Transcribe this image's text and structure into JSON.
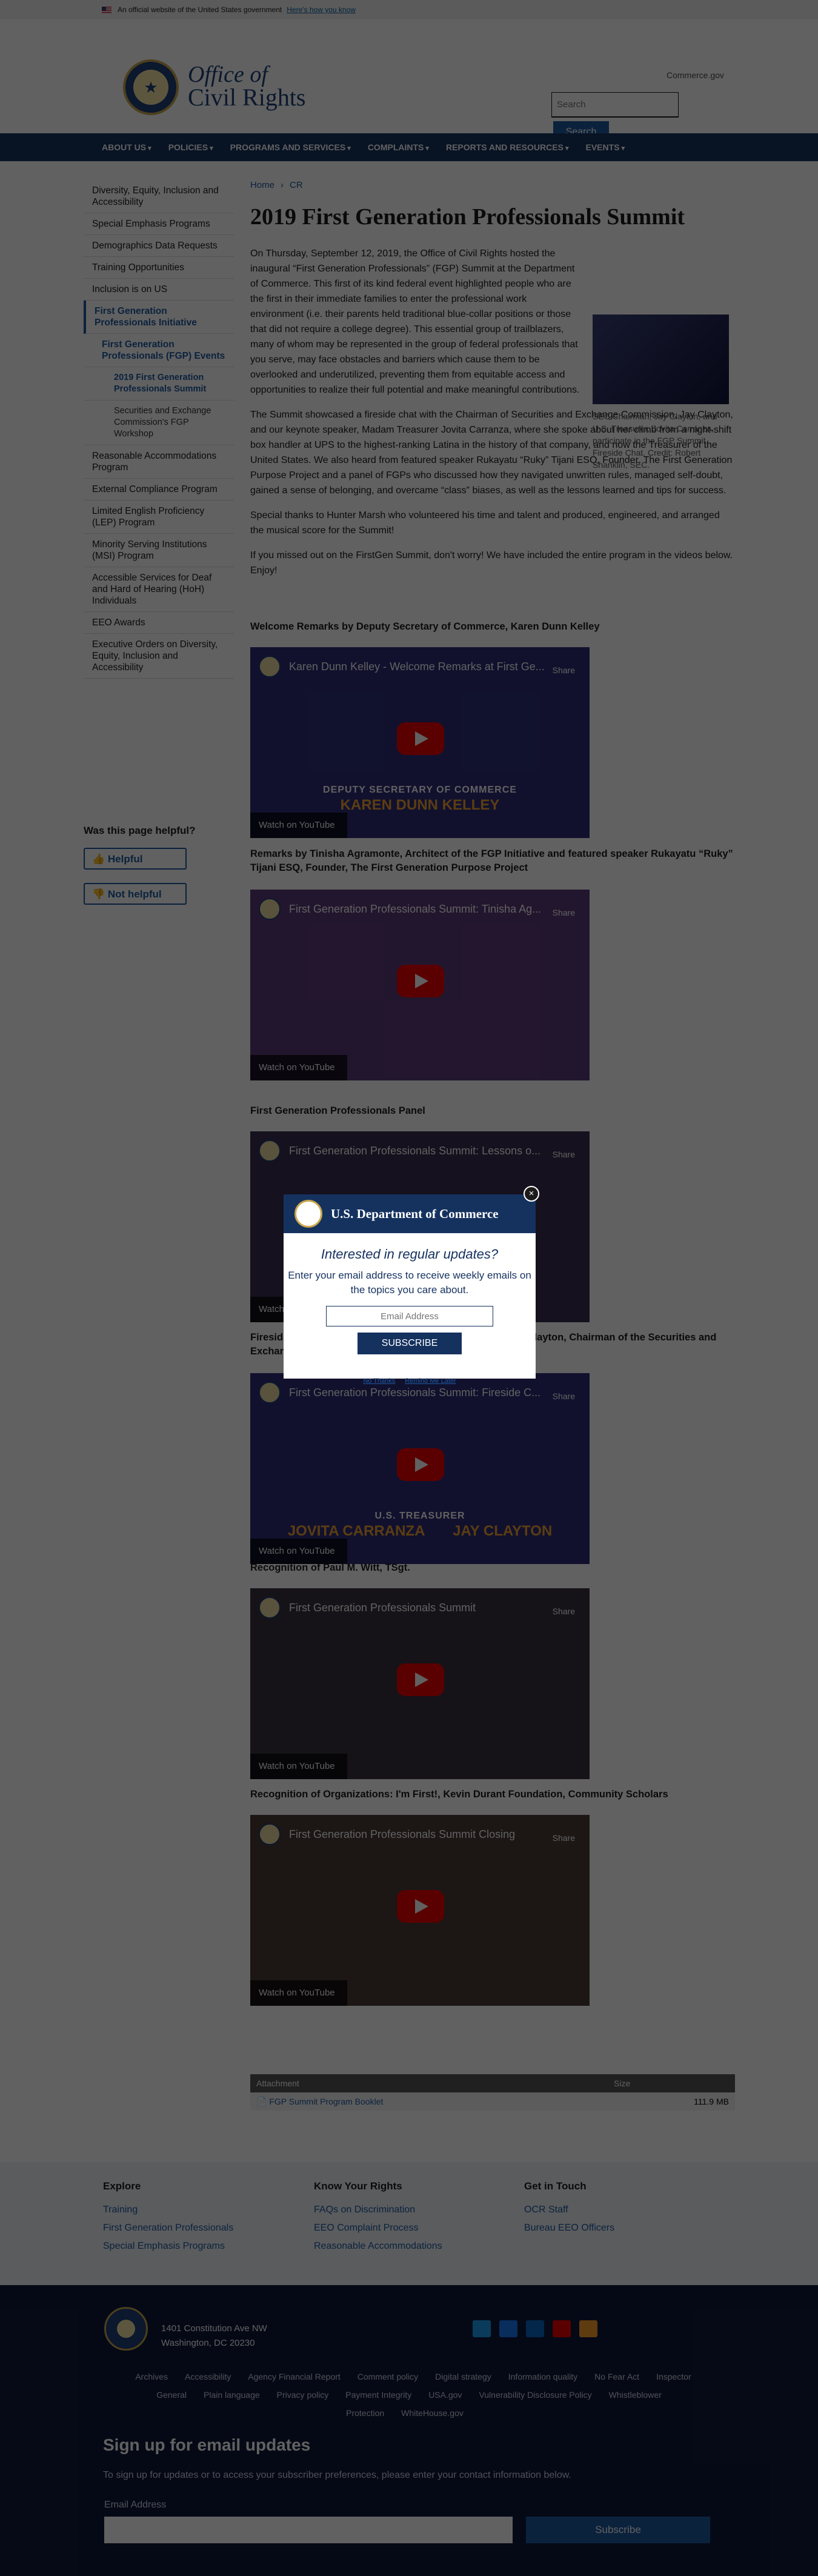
{
  "banner": {
    "text": "An official website of the United States government",
    "link": "Here's how you know"
  },
  "header": {
    "title_line1": "Office of",
    "title_line2": "Civil Rights",
    "commerce_link": "Commerce.gov",
    "search_placeholder": "Search",
    "search_button": "Search"
  },
  "nav": [
    "ABOUT US",
    "POLICIES",
    "PROGRAMS AND SERVICES",
    "COMPLAINTS",
    "REPORTS AND RESOURCES",
    "EVENTS"
  ],
  "sidebar": [
    "Diversity, Equity, Inclusion and Accessibility",
    "Special Emphasis Programs",
    "Demographics Data Requests",
    "Training Opportunities",
    "Inclusion is on US",
    "First Generation Professionals Initiative",
    "First Generation Professionals (FGP) Events",
    "2019 First Generation Professionals Summit",
    "Securities and Exchange Commission's FGP Workshop",
    "Reasonable Accommodations Program",
    "External Compliance Program",
    "Limited English Proficiency (LEP) Program",
    "Minority Serving Institutions (MSI) Program",
    "Accessible Services for Deaf and Hard of Hearing (HoH) Individuals",
    "EEO Awards",
    "Executive Orders on Diversity, Equity, Inclusion and Accessibility"
  ],
  "feedback": {
    "title": "Was this page helpful?",
    "yes": "Helpful",
    "no": "Not helpful"
  },
  "breadcrumb": [
    "Home",
    "CR"
  ],
  "page_title": "2019 First Generation Professionals Summit",
  "figure_caption": "SEC Chairman, Jay Clayton, and U.S. Treasurer, Jovita Carranza, participate in the FGP Summit Fireside Chat. Credit: Robert Shanklin, SEC.",
  "paragraphs": [
    "On Thursday, September 12, 2019, the Office of Civil Rights hosted the inaugural “First Generation Professionals” (FGP) Summit at the Department of Commerce. This first of its kind federal event highlighted people who are the first in their immediate families to enter the professional work environment (i.e. their parents held traditional blue-collar positions or those that did not require a college degree). This essential group of trailblazers, many of whom may be represented in the group of federal professionals that you serve, may face obstacles and barriers which cause them to be overlooked and underutilized, preventing them from equitable access and opportunities to realize their full potential and make meaningful contributions.",
    "The Summit showcased a fireside chat with the Chairman of Securities and Exchange Commission, Jay Clayton, and our keynote speaker, Madam Treasurer Jovita Carranza, where she spoke about her climb from a night-shift box handler at UPS to the highest-ranking Latina in the history of that company, and now the Treasurer of the United States. We also heard from featured speaker Rukayatu “Ruky” Tijani ESQ, Founder, The First Generation Purpose Project and a panel of FGPs who discussed how they navigated unwritten rules, managed self-doubt, gained a sense of belonging, and overcame “class” biases, as well as the lessons learned and tips for success.",
    "Special thanks to Hunter Marsh who volunteered his time and talent and produced, engineered, and arranged the musical score for the Summit!",
    "If you missed out on the FirstGen Summit, don't worry! We have included the entire program in the videos below. Enjoy!"
  ],
  "sections": [
    {
      "title": "Welcome Remarks by Deputy Secretary of Commerce, Karen Dunn Kelley",
      "video_title": "Karen Dunn Kelley - Welcome Remarks at First Ge...",
      "bg": "#2d2f7a",
      "cap1": "DEPUTY SECRETARY OF COMMERCE",
      "cap2": "KAREN DUNN KELLEY"
    },
    {
      "title": "Remarks by Tinisha Agramonte, Architect of the FGP Initiative and featured speaker Rukayatu “Ruky” Tijani ESQ, Founder, The First Generation Purpose Project",
      "video_title": "First Generation Professionals Summit: Tinisha Ag...",
      "bg": "#5b3a7a",
      "cap1": "",
      "cap2": ""
    },
    {
      "title": "First Generation Professionals Panel",
      "video_title": "First Generation Professionals Summit: Lessons o...",
      "bg": "#3a2f4f",
      "cap1": "",
      "cap2": ""
    },
    {
      "title": "Fireside Chat with U.S. Treasurer Jovita Carranza and Jay Clayton, Chairman of the Securities and Exchange Commission",
      "video_title": "First Generation Professionals Summit: Fireside C...",
      "bg": "#2d2f7a",
      "cap1": "U.S. TREASURER",
      "cap2": "JOVITA CARRANZA       JAY CLAYTON"
    },
    {
      "title": "Recognition of Paul M. Witt, TSgt.",
      "video_title": "First Generation Professionals Summit",
      "bg": "#3a3340",
      "cap1": "",
      "cap2": ""
    },
    {
      "title": "Recognition of Organizations: I'm First!, Kevin Durant Foundation, Community Scholars",
      "video_title": "First Generation Professionals Summit Closing",
      "bg": "#4a3a38",
      "cap1": "",
      "cap2": ""
    }
  ],
  "video_share": "Share",
  "video_watch": "Watch on YouTube",
  "attachments": {
    "head_name": "Attachment",
    "head_size": "Size",
    "file": "FGP Summit Program Booklet",
    "size": "111.9 MB"
  },
  "footer": {
    "explore_title": "Explore",
    "explore": [
      "Training",
      "First Generation Professionals",
      "Special Emphasis Programs"
    ],
    "rights_title": "Know Your Rights",
    "rights": [
      "FAQs on Discrimination",
      "EEO Complaint Process",
      "Reasonable Accommodations"
    ],
    "touch_title": "Get in Touch",
    "touch": [
      "OCR Staff",
      "Bureau EEO Officers"
    ],
    "address1": "1401 Constitution Ave NW",
    "address2": "Washington, DC 20230",
    "social": [
      {
        "icon": "twitter-icon",
        "color": "#1d9bf0"
      },
      {
        "icon": "facebook-icon",
        "color": "#1877f2"
      },
      {
        "icon": "linkedin-icon",
        "color": "#0a66c2"
      },
      {
        "icon": "youtube-icon",
        "color": "#e00"
      },
      {
        "icon": "rss-icon",
        "color": "#f99b2a"
      }
    ],
    "links": [
      "Archives",
      "Accessibility",
      "Agency Financial Report",
      "Comment policy",
      "Digital strategy",
      "Information quality",
      "No Fear Act",
      "Inspector General",
      "Plain language",
      "Privacy policy",
      "Payment Integrity",
      "USA.gov",
      "Vulnerability Disclosure Policy",
      "Whistleblower Protection",
      "WhiteHouse.gov"
    ],
    "email_title": "Sign up for email updates",
    "email_desc": "To sign up for updates or to access your subscriber preferences, please enter your contact information below.",
    "email_label": "Email Address",
    "email_button": "Subscribe"
  },
  "modal": {
    "title": "U.S. Department of Commerce",
    "close": "×",
    "question": "Interested in regular updates?",
    "desc": "Enter your email address to receive weekly emails on the topics you care about.",
    "placeholder": "Email Address",
    "button": "SUBSCRIBE",
    "no_thanks": "No Thanks",
    "remind": "Remind Me Later"
  }
}
